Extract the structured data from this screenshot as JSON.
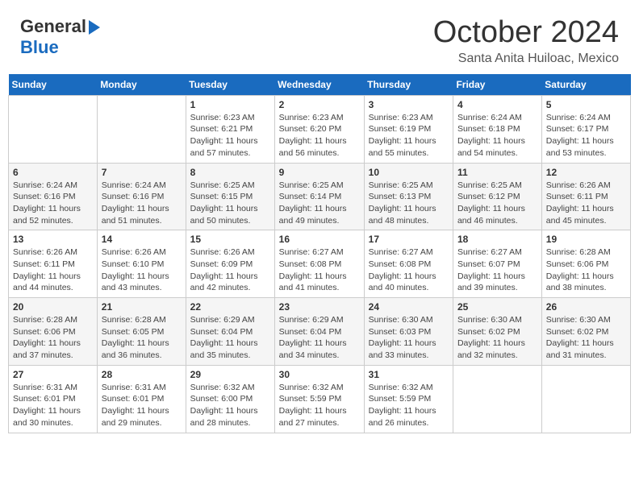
{
  "header": {
    "logo_general": "General",
    "logo_blue": "Blue",
    "month_title": "October 2024",
    "location": "Santa Anita Huiloac, Mexico"
  },
  "calendar": {
    "days_of_week": [
      "Sunday",
      "Monday",
      "Tuesday",
      "Wednesday",
      "Thursday",
      "Friday",
      "Saturday"
    ],
    "weeks": [
      [
        {
          "day": "",
          "sunrise": "",
          "sunset": "",
          "daylight": ""
        },
        {
          "day": "",
          "sunrise": "",
          "sunset": "",
          "daylight": ""
        },
        {
          "day": "1",
          "sunrise": "Sunrise: 6:23 AM",
          "sunset": "Sunset: 6:21 PM",
          "daylight": "Daylight: 11 hours and 57 minutes."
        },
        {
          "day": "2",
          "sunrise": "Sunrise: 6:23 AM",
          "sunset": "Sunset: 6:20 PM",
          "daylight": "Daylight: 11 hours and 56 minutes."
        },
        {
          "day": "3",
          "sunrise": "Sunrise: 6:23 AM",
          "sunset": "Sunset: 6:19 PM",
          "daylight": "Daylight: 11 hours and 55 minutes."
        },
        {
          "day": "4",
          "sunrise": "Sunrise: 6:24 AM",
          "sunset": "Sunset: 6:18 PM",
          "daylight": "Daylight: 11 hours and 54 minutes."
        },
        {
          "day": "5",
          "sunrise": "Sunrise: 6:24 AM",
          "sunset": "Sunset: 6:17 PM",
          "daylight": "Daylight: 11 hours and 53 minutes."
        }
      ],
      [
        {
          "day": "6",
          "sunrise": "Sunrise: 6:24 AM",
          "sunset": "Sunset: 6:16 PM",
          "daylight": "Daylight: 11 hours and 52 minutes."
        },
        {
          "day": "7",
          "sunrise": "Sunrise: 6:24 AM",
          "sunset": "Sunset: 6:16 PM",
          "daylight": "Daylight: 11 hours and 51 minutes."
        },
        {
          "day": "8",
          "sunrise": "Sunrise: 6:25 AM",
          "sunset": "Sunset: 6:15 PM",
          "daylight": "Daylight: 11 hours and 50 minutes."
        },
        {
          "day": "9",
          "sunrise": "Sunrise: 6:25 AM",
          "sunset": "Sunset: 6:14 PM",
          "daylight": "Daylight: 11 hours and 49 minutes."
        },
        {
          "day": "10",
          "sunrise": "Sunrise: 6:25 AM",
          "sunset": "Sunset: 6:13 PM",
          "daylight": "Daylight: 11 hours and 48 minutes."
        },
        {
          "day": "11",
          "sunrise": "Sunrise: 6:25 AM",
          "sunset": "Sunset: 6:12 PM",
          "daylight": "Daylight: 11 hours and 46 minutes."
        },
        {
          "day": "12",
          "sunrise": "Sunrise: 6:26 AM",
          "sunset": "Sunset: 6:11 PM",
          "daylight": "Daylight: 11 hours and 45 minutes."
        }
      ],
      [
        {
          "day": "13",
          "sunrise": "Sunrise: 6:26 AM",
          "sunset": "Sunset: 6:11 PM",
          "daylight": "Daylight: 11 hours and 44 minutes."
        },
        {
          "day": "14",
          "sunrise": "Sunrise: 6:26 AM",
          "sunset": "Sunset: 6:10 PM",
          "daylight": "Daylight: 11 hours and 43 minutes."
        },
        {
          "day": "15",
          "sunrise": "Sunrise: 6:26 AM",
          "sunset": "Sunset: 6:09 PM",
          "daylight": "Daylight: 11 hours and 42 minutes."
        },
        {
          "day": "16",
          "sunrise": "Sunrise: 6:27 AM",
          "sunset": "Sunset: 6:08 PM",
          "daylight": "Daylight: 11 hours and 41 minutes."
        },
        {
          "day": "17",
          "sunrise": "Sunrise: 6:27 AM",
          "sunset": "Sunset: 6:08 PM",
          "daylight": "Daylight: 11 hours and 40 minutes."
        },
        {
          "day": "18",
          "sunrise": "Sunrise: 6:27 AM",
          "sunset": "Sunset: 6:07 PM",
          "daylight": "Daylight: 11 hours and 39 minutes."
        },
        {
          "day": "19",
          "sunrise": "Sunrise: 6:28 AM",
          "sunset": "Sunset: 6:06 PM",
          "daylight": "Daylight: 11 hours and 38 minutes."
        }
      ],
      [
        {
          "day": "20",
          "sunrise": "Sunrise: 6:28 AM",
          "sunset": "Sunset: 6:06 PM",
          "daylight": "Daylight: 11 hours and 37 minutes."
        },
        {
          "day": "21",
          "sunrise": "Sunrise: 6:28 AM",
          "sunset": "Sunset: 6:05 PM",
          "daylight": "Daylight: 11 hours and 36 minutes."
        },
        {
          "day": "22",
          "sunrise": "Sunrise: 6:29 AM",
          "sunset": "Sunset: 6:04 PM",
          "daylight": "Daylight: 11 hours and 35 minutes."
        },
        {
          "day": "23",
          "sunrise": "Sunrise: 6:29 AM",
          "sunset": "Sunset: 6:04 PM",
          "daylight": "Daylight: 11 hours and 34 minutes."
        },
        {
          "day": "24",
          "sunrise": "Sunrise: 6:30 AM",
          "sunset": "Sunset: 6:03 PM",
          "daylight": "Daylight: 11 hours and 33 minutes."
        },
        {
          "day": "25",
          "sunrise": "Sunrise: 6:30 AM",
          "sunset": "Sunset: 6:02 PM",
          "daylight": "Daylight: 11 hours and 32 minutes."
        },
        {
          "day": "26",
          "sunrise": "Sunrise: 6:30 AM",
          "sunset": "Sunset: 6:02 PM",
          "daylight": "Daylight: 11 hours and 31 minutes."
        }
      ],
      [
        {
          "day": "27",
          "sunrise": "Sunrise: 6:31 AM",
          "sunset": "Sunset: 6:01 PM",
          "daylight": "Daylight: 11 hours and 30 minutes."
        },
        {
          "day": "28",
          "sunrise": "Sunrise: 6:31 AM",
          "sunset": "Sunset: 6:01 PM",
          "daylight": "Daylight: 11 hours and 29 minutes."
        },
        {
          "day": "29",
          "sunrise": "Sunrise: 6:32 AM",
          "sunset": "Sunset: 6:00 PM",
          "daylight": "Daylight: 11 hours and 28 minutes."
        },
        {
          "day": "30",
          "sunrise": "Sunrise: 6:32 AM",
          "sunset": "Sunset: 5:59 PM",
          "daylight": "Daylight: 11 hours and 27 minutes."
        },
        {
          "day": "31",
          "sunrise": "Sunrise: 6:32 AM",
          "sunset": "Sunset: 5:59 PM",
          "daylight": "Daylight: 11 hours and 26 minutes."
        },
        {
          "day": "",
          "sunrise": "",
          "sunset": "",
          "daylight": ""
        },
        {
          "day": "",
          "sunrise": "",
          "sunset": "",
          "daylight": ""
        }
      ]
    ]
  }
}
